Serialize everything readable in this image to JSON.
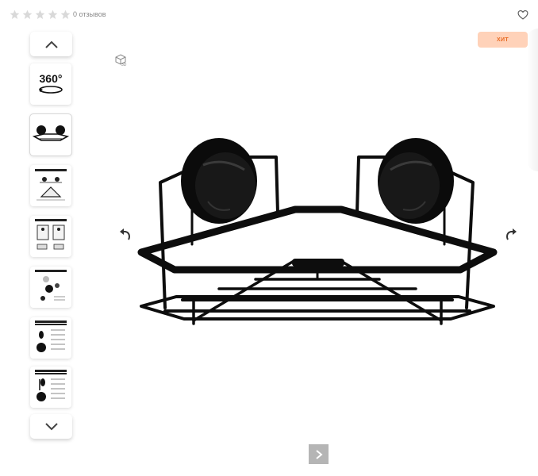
{
  "rating": {
    "stars_total": 5,
    "stars_filled": 0,
    "reviews_label": "0 отзывов",
    "star_color": "#d9d9d9"
  },
  "badge": {
    "label": "ХИТ",
    "bg_color": "#ffd2b9",
    "text_color": "#e86a22"
  },
  "thumbnails": {
    "first_label": "360°",
    "items": [
      "thumb-360",
      "thumb-product-front",
      "thumb-dimensions",
      "thumb-packaging",
      "thumb-mounting-steps",
      "thumb-instructions-1",
      "thumb-instructions-2"
    ]
  },
  "icons": {
    "favorite": "heart-icon",
    "scroll_up": "chevron-up-icon",
    "scroll_down": "chevron-down-icon",
    "view_3d": "cube-3d-icon",
    "rotate_left": "rotate-left-icon",
    "rotate_right": "rotate-right-icon",
    "next": "chevron-right-icon"
  },
  "colors": {
    "next_button": "#b5b5b5",
    "product": "#111111"
  }
}
